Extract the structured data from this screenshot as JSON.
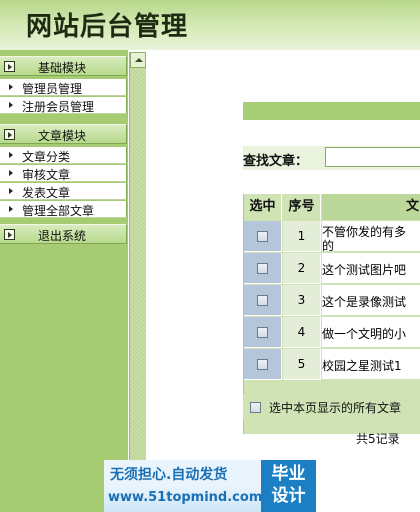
{
  "header": {
    "title": "网站后台管理"
  },
  "sidebar": {
    "groups": [
      {
        "title": "基础模块",
        "items": [
          "管理员管理",
          "注册会员管理"
        ]
      },
      {
        "title": "文章模块",
        "items": [
          "文章分类",
          "审核文章",
          "发表文章",
          "管理全部文章"
        ]
      },
      {
        "title": "退出系统",
        "items": []
      }
    ]
  },
  "search": {
    "label": "查找文章：",
    "value": ""
  },
  "table": {
    "headers": {
      "select": "选中",
      "number": "序号",
      "title": "文"
    },
    "rows": [
      {
        "num": "1",
        "title_line1": "不管你发的有多",
        "title_line2": "的"
      },
      {
        "num": "2",
        "title_line1": "这个测试图片吧",
        "title_line2": ""
      },
      {
        "num": "3",
        "title_line1": "这个是录像测试",
        "title_line2": ""
      },
      {
        "num": "4",
        "title_line1": "做一个文明的小",
        "title_line2": ""
      },
      {
        "num": "5",
        "title_line1": "校园之星测试1",
        "title_line2": ""
      }
    ]
  },
  "select_all": {
    "label": "选中本页显示的所有文章"
  },
  "pagination": {
    "total": "共5记录"
  },
  "banner": {
    "slogan": "无须担心.自动发货",
    "url": "www.51topmind.com",
    "tag_line1": "毕业",
    "tag_line2": "设计"
  },
  "colors": {
    "sidebar": "#a6cb73",
    "header": "#c4df9e",
    "table_header": "#cfe3b4",
    "select_col": "#b5c6db",
    "banner": "#1c7fc4"
  }
}
